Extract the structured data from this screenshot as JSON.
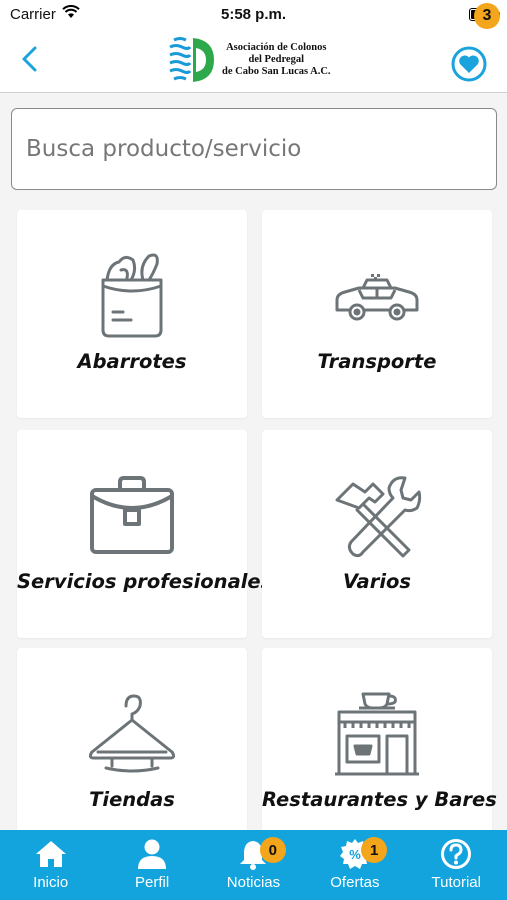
{
  "status_bar": {
    "carrier": "Carrier",
    "time": "5:58 p.m.",
    "wifi_icon": "wifi-icon",
    "battery_icon": "battery-icon"
  },
  "header": {
    "back_icon": "chevron-left-icon",
    "logo": {
      "line1": "Asociación de Colonos",
      "line2": "del Pedregal",
      "line3": "de Cabo San Lucas A.C."
    },
    "favorites_icon": "heart-icon",
    "favorites_count": "3",
    "accent_color": "#1aa3dc"
  },
  "search": {
    "placeholder": "Busca producto/servicio",
    "value": ""
  },
  "categories": [
    {
      "label": "Abarrotes",
      "icon": "grocery-bag-icon"
    },
    {
      "label": "Transporte",
      "icon": "taxi-icon"
    },
    {
      "label": "Servicios profesionales",
      "icon": "briefcase-icon"
    },
    {
      "label": "Varios",
      "icon": "tools-icon"
    },
    {
      "label": "Tiendas",
      "icon": "hanger-icon"
    },
    {
      "label": "Restaurantes y Bares",
      "icon": "cafe-storefront-icon"
    }
  ],
  "tabbar": {
    "background": "#14a4dd",
    "badge_color": "#f3a51c",
    "items": [
      {
        "label": "Inicio",
        "icon": "home-icon"
      },
      {
        "label": "Perfil",
        "icon": "user-icon"
      },
      {
        "label": "Noticias",
        "icon": "bell-icon",
        "badge": "0"
      },
      {
        "label": "Ofertas",
        "icon": "discount-badge-icon",
        "badge": "1"
      },
      {
        "label": "Tutorial",
        "icon": "help-icon"
      }
    ]
  }
}
